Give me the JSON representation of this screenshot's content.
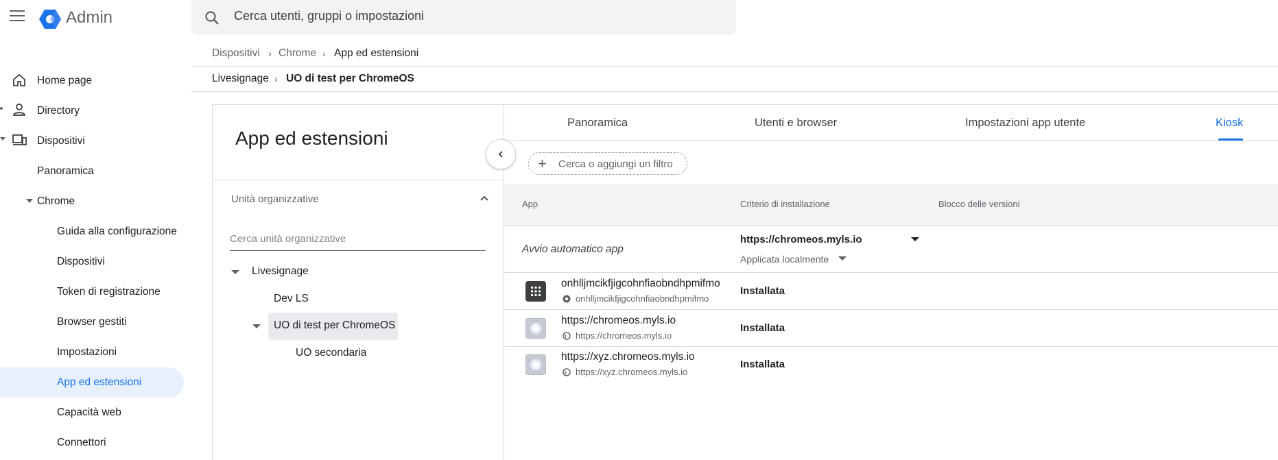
{
  "header": {
    "app_title": "Admin",
    "search_placeholder": "Cerca utenti, gruppi o impostazioni"
  },
  "sidebar": {
    "items": [
      {
        "label": "Home page",
        "icon": "home-icon"
      },
      {
        "label": "Directory",
        "icon": "person-icon"
      },
      {
        "label": "Dispositivi",
        "icon": "devices-icon"
      },
      {
        "label": "Panoramica"
      },
      {
        "label": "Chrome"
      },
      {
        "label": "Guida alla configurazione"
      },
      {
        "label": "Dispositivi"
      },
      {
        "label": "Token di registrazione"
      },
      {
        "label": "Browser gestiti"
      },
      {
        "label": "Impostazioni"
      },
      {
        "label": "App ed estensioni"
      },
      {
        "label": "Capacità web"
      },
      {
        "label": "Connettori"
      }
    ]
  },
  "breadcrumb": [
    "Dispositivi",
    "Chrome",
    "App ed estensioni"
  ],
  "ou_breadcrumb": [
    "Livesignage",
    "UO di test per ChromeOS"
  ],
  "left_panel": {
    "title": "App ed estensioni",
    "ou_header": "Unità organizzative",
    "ou_search_placeholder": "Cerca unità organizzative",
    "tree": [
      "Livesignage",
      "Dev LS",
      "UO di test per ChromeOS",
      "UO secondaria"
    ]
  },
  "tabs": [
    "Panoramica",
    "Utenti e browser",
    "Impostazioni app utente",
    "Kiosk"
  ],
  "filter_label": "Cerca o aggiungi un filtro",
  "table": {
    "headers": [
      "App",
      "Criterio di installazione",
      "Blocco delle versioni"
    ],
    "auto_launch": {
      "label": "Avvio automatico app",
      "value": "https://chromeos.myls.io",
      "sub": "Applicata localmente"
    },
    "rows": [
      {
        "name": "onhlljmcikfjigcohnfiaobndhpmifmo",
        "sub": "onhlljmcikfjigcohnfiaobndhpmifmo",
        "policy": "Installata",
        "icon": "apps-grid-icon",
        "sub_icon": "chrome-icon"
      },
      {
        "name": "https://chromeos.myls.io",
        "sub": "https://chromeos.myls.io",
        "policy": "Installata",
        "icon": "web-app-icon",
        "sub_icon": "globe-icon"
      },
      {
        "name": "https://xyz.chromeos.myls.io",
        "sub": "https://xyz.chromeos.myls.io",
        "policy": "Installata",
        "icon": "web-app-icon",
        "sub_icon": "globe-icon"
      }
    ]
  },
  "colors": {
    "accent": "#1a73e8",
    "active_bg": "#e8f0fe",
    "header_bg": "#f1f3f4"
  }
}
